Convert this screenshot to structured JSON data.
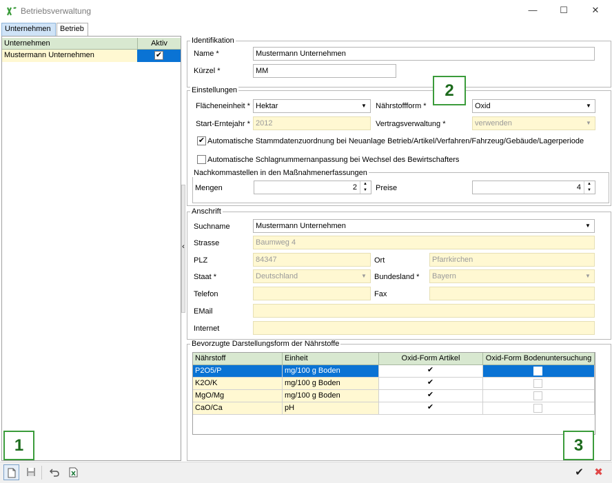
{
  "window": {
    "title": "Betriebsverwaltung",
    "minimize": "—",
    "maximize": "☐",
    "close": "✕"
  },
  "tabs": [
    "Unternehmen",
    "Betrieb"
  ],
  "company_list": {
    "headers": [
      "Unternehmen",
      "Aktiv"
    ],
    "rows": [
      {
        "name": "Mustermann Unternehmen",
        "active": true
      }
    ],
    "splitter_glyph": "‹"
  },
  "identifikation": {
    "title": "Identifikation",
    "name_label": "Name *",
    "name_value": "Mustermann Unternehmen",
    "kuerzel_label": "Kürzel *",
    "kuerzel_value": "MM"
  },
  "einstellungen": {
    "title": "Einstellungen",
    "flaecheneinheit_label": "Flächeneinheit *",
    "flaecheneinheit_value": "Hektar",
    "naehrstoffform_label": "Nährstoffform *",
    "naehrstoffform_value": "Oxid",
    "start_erntejahr_label": "Start-Erntejahr *",
    "start_erntejahr_value": "2012",
    "vertragsverwaltung_label": "Vertragsverwaltung *",
    "vertragsverwaltung_value": "verwenden",
    "auto_stammdaten_label": "Automatische Stammdatenzuordnung bei Neuanlage Betrieb/Artikel/Verfahren/Fahrzeug/Gebäude/Lagerperiode",
    "auto_stammdaten_checked": true,
    "auto_schlag_label": "Automatische Schlagnummernanpassung bei Wechsel des Bewirtschafters",
    "auto_schlag_checked": false
  },
  "nachkommastellen": {
    "title": "Nachkommastellen in den Maßnahmenerfassungen",
    "mengen_label": "Mengen",
    "mengen_value": "2",
    "preise_label": "Preise",
    "preise_value": "4"
  },
  "anschrift": {
    "title": "Anschrift",
    "suchname_label": "Suchname",
    "suchname_value": "Mustermann Unternehmen",
    "strasse_label": "Strasse",
    "strasse_value": "Baumweg 4",
    "plz_label": "PLZ",
    "plz_value": "84347",
    "ort_label": "Ort",
    "ort_value": "Pfarrkirchen",
    "staat_label": "Staat *",
    "staat_value": "Deutschland",
    "bundesland_label": "Bundesland *",
    "bundesland_value": "Bayern",
    "telefon_label": "Telefon",
    "telefon_value": "",
    "fax_label": "Fax",
    "fax_value": "",
    "email_label": "EMail",
    "email_value": "",
    "internet_label": "Internet",
    "internet_value": ""
  },
  "naehrstoffe": {
    "title": "Bevorzugte Darstellungsform der Nährstoffe",
    "headers": [
      "Nährstoff",
      "Einheit",
      "Oxid-Form Artikel",
      "Oxid-Form Bodenuntersuchung"
    ],
    "rows": [
      {
        "naehrstoff": "P2O5/P",
        "einheit": "mg/100 g Boden",
        "oxid_artikel": true,
        "oxid_boden": false
      },
      {
        "naehrstoff": "K2O/K",
        "einheit": "mg/100 g Boden",
        "oxid_artikel": true,
        "oxid_boden": false
      },
      {
        "naehrstoff": "MgO/Mg",
        "einheit": "mg/100 g Boden",
        "oxid_artikel": true,
        "oxid_boden": false
      },
      {
        "naehrstoff": "CaO/Ca",
        "einheit": "pH",
        "oxid_artikel": true,
        "oxid_boden": false
      }
    ]
  },
  "callouts": [
    "1",
    "2",
    "3"
  ],
  "toolbar": {
    "new_icon": "new-document-icon",
    "save_icon": "save-icon",
    "undo_icon": "undo-icon",
    "export_icon": "excel-export-icon",
    "confirm_glyph": "✔",
    "cancel_glyph": "✖"
  },
  "colors": {
    "header_green": "#d8e8d0",
    "readonly_yellow": "#fff8d2",
    "selection_blue": "#0a73d4",
    "callout_green": "#3a9b3a",
    "cancel_red": "#e04848"
  }
}
